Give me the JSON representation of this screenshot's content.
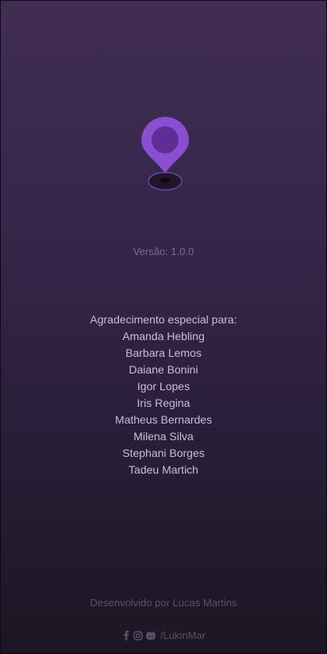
{
  "app": {
    "version_label": "Versão: 1.0.0"
  },
  "credits": {
    "heading": "Agradecimento especial para:",
    "names": [
      "Amanda Hebling",
      "Barbara Lemos",
      "Daiane Bonini",
      "Igor Lopes",
      "Iris Regina",
      "Matheus Bernardes",
      "Milena Silva",
      "Stephani Borges",
      "Tadeu Martich"
    ]
  },
  "footer": {
    "developed_by": "Desenvolvido por Lucas Martins",
    "social_handle": "/LukinMar",
    "icons": [
      "facebook-icon",
      "instagram-icon",
      "github-icon"
    ]
  },
  "colors": {
    "accent": "#8a4fd0",
    "background_top": "#422d55",
    "background_bottom": "#1c1623"
  }
}
